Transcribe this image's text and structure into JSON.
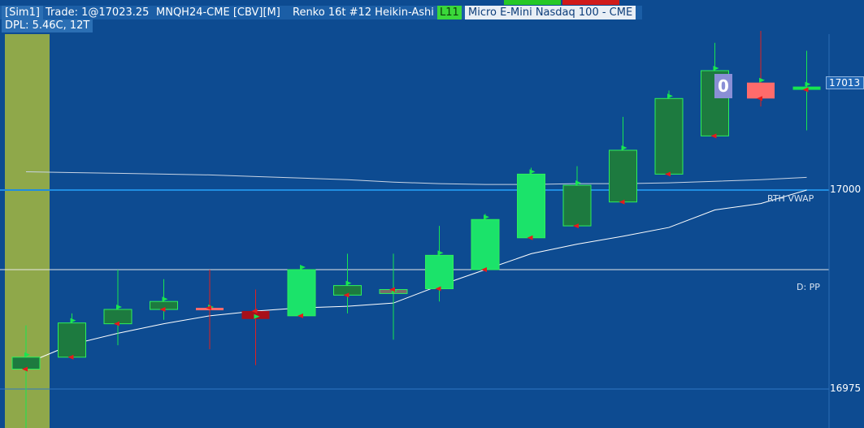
{
  "header": {
    "account": "[Sim1]",
    "trade": "Trade: 1@17023.25",
    "symbol": "MNQH24-CME [CBV][M]",
    "bar_type": "Renko 16t #12 Heikin-Ashi",
    "level": "L11",
    "instrument": "Micro E-Mini Nasdaq 100 - CME",
    "dpl": "DPL: 5.46C, 12T"
  },
  "price_axis": {
    "current_price_label": "17013",
    "label_17000": "17000",
    "label_16975": "16975"
  },
  "annotations": {
    "rth_vwap": "RTH VWAP",
    "daily_pp": "D: PP",
    "box_label": "0"
  },
  "colors": {
    "background": "#0d4b91",
    "session_highlight": "#8fa84a",
    "up_bar": "#1d7a3f",
    "up_bar_bright": "#1be36a",
    "down_bar": "#ff6b6b",
    "down_bar_dark": "#a8101a",
    "wick": "#17e650",
    "vwap_line": "#ffffff",
    "pivot_line": "#e8e8e8",
    "gridline_17000": "#1f8de0"
  },
  "chart_data": {
    "type": "candlestick",
    "title": "MNQH24-CME Renko 16t #12 Heikin-Ashi",
    "ylabel": "",
    "y_ticks": [
      16975,
      17000
    ],
    "ylim": [
      16970,
      17020
    ],
    "horizontal_lines": [
      {
        "name": "D: PP",
        "value": 16990.0
      },
      {
        "name": "17000 level",
        "value": 17000.0
      }
    ],
    "current_price": 17013,
    "bars": [
      {
        "open": 16977.5,
        "close": 16979.0,
        "high": 16983.0,
        "low": 16969.5,
        "color": "up"
      },
      {
        "open": 16979.0,
        "close": 16983.3,
        "high": 16984.5,
        "low": 16979.0,
        "color": "up"
      },
      {
        "open": 16983.2,
        "close": 16985.0,
        "high": 16990.0,
        "low": 16980.5,
        "color": "up"
      },
      {
        "open": 16985.0,
        "close": 16986.0,
        "high": 16988.8,
        "low": 16983.7,
        "color": "up"
      },
      {
        "open": 16985.2,
        "close": 16985.0,
        "high": 16990.0,
        "low": 16980.0,
        "color": "down"
      },
      {
        "open": 16984.8,
        "close": 16983.8,
        "high": 16987.5,
        "low": 16978.0,
        "color": "down_dark"
      },
      {
        "open": 16984.2,
        "close": 16990.0,
        "high": 16990.3,
        "low": 16984.2,
        "color": "up_bright"
      },
      {
        "open": 16986.8,
        "close": 16988.0,
        "high": 16992.0,
        "low": 16984.5,
        "color": "up"
      },
      {
        "open": 16987.5,
        "close": 16987.0,
        "high": 16992.0,
        "low": 16981.2,
        "color": "down_gray"
      },
      {
        "open": 16987.6,
        "close": 16991.8,
        "high": 16995.5,
        "low": 16986.0,
        "color": "up_bright"
      },
      {
        "open": 16990.0,
        "close": 16996.3,
        "high": 16997.0,
        "low": 16990.0,
        "color": "up_bright"
      },
      {
        "open": 16994.0,
        "close": 17002.0,
        "high": 17002.8,
        "low": 16994.0,
        "color": "up_bright"
      },
      {
        "open": 16995.5,
        "close": 17000.6,
        "high": 17003.0,
        "low": 16995.5,
        "color": "up"
      },
      {
        "open": 16998.5,
        "close": 17005.0,
        "high": 17009.2,
        "low": 16998.5,
        "color": "up"
      },
      {
        "open": 17002.0,
        "close": 17011.5,
        "high": 17012.5,
        "low": 17002.0,
        "color": "up"
      },
      {
        "open": 17006.8,
        "close": 17015.0,
        "high": 17018.5,
        "low": 17006.8,
        "color": "up"
      },
      {
        "open": 17011.5,
        "close": 17013.5,
        "high": 17020.0,
        "low": 17010.5,
        "color": "down"
      },
      {
        "open": 17012.6,
        "close": 17013.0,
        "high": 17017.5,
        "low": 17007.5,
        "color": "up_cross"
      }
    ],
    "series": [
      {
        "name": "RTH VWAP",
        "values": [
          16978.2,
          16980.6,
          16982.0,
          16983.2,
          16984.2,
          16984.8,
          16985.2,
          16985.4,
          16985.8,
          16988.0,
          16990.0,
          16992.0,
          16993.2,
          16994.2,
          16995.3,
          16997.5,
          16998.3,
          17000.0
        ]
      },
      {
        "name": "Prior VWAP",
        "values": [
          17002.3,
          17002.2,
          17002.1,
          17002.0,
          17001.9,
          17001.7,
          17001.5,
          17001.3,
          17001.0,
          17000.8,
          17000.7,
          17000.7,
          17000.8,
          17000.8,
          17000.9,
          17001.1,
          17001.3,
          17001.6
        ]
      }
    ]
  }
}
